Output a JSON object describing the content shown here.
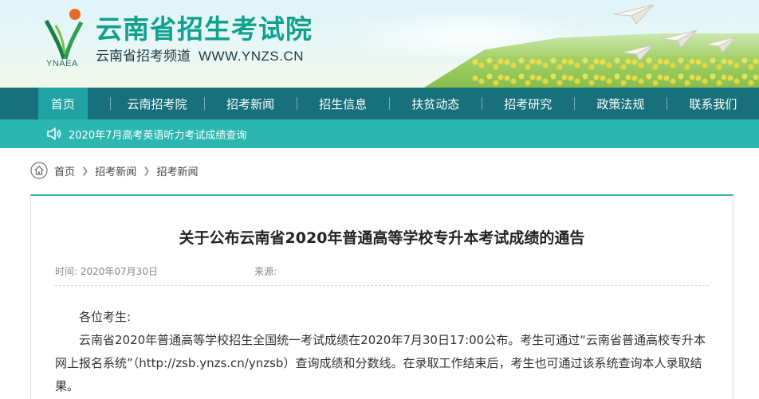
{
  "header": {
    "logo_text": "YNAEA",
    "site_title": "云南省招生考试院",
    "site_sub": "云南省招考频道",
    "site_url": "WWW.YNZS.CN"
  },
  "nav": {
    "items": [
      {
        "label": "首页",
        "active": true
      },
      {
        "label": "云南招考院"
      },
      {
        "label": "招考新闻"
      },
      {
        "label": "招生信息"
      },
      {
        "label": "扶贫动态"
      },
      {
        "label": "招考研究"
      },
      {
        "label": "政策法规"
      },
      {
        "label": "联系我们"
      }
    ]
  },
  "notice": {
    "icon": "speaker-icon",
    "text": "2020年7月高考英语听力考试成绩查询"
  },
  "breadcrumb": {
    "icon": "home-icon",
    "items": [
      "首页",
      "招考新闻",
      "招考新闻"
    ]
  },
  "article": {
    "title": "关于公布云南省2020年普通高等学校专升本考试成绩的通告",
    "time_label": "时间:",
    "time_value": "2020年07月30日",
    "source_label": "来源:",
    "greeting": "各位考生:",
    "paragraph": "云南省2020年普通高等学校招生全国统一考试成绩在2020年7月30日17:00公布。考生可通过“云南省普通高校专升本网上报名系统”（http://zsb.ynzs.cn/ynzsb）查询成绩和分数线。在录取工作结束后，考生也可通过该系统查询本人录取结果。"
  },
  "colors": {
    "nav_bg": "#17707a",
    "nav_active": "#1fa3a3",
    "notice_bg": "#2bb7b0",
    "title_green": "#10a18e"
  }
}
